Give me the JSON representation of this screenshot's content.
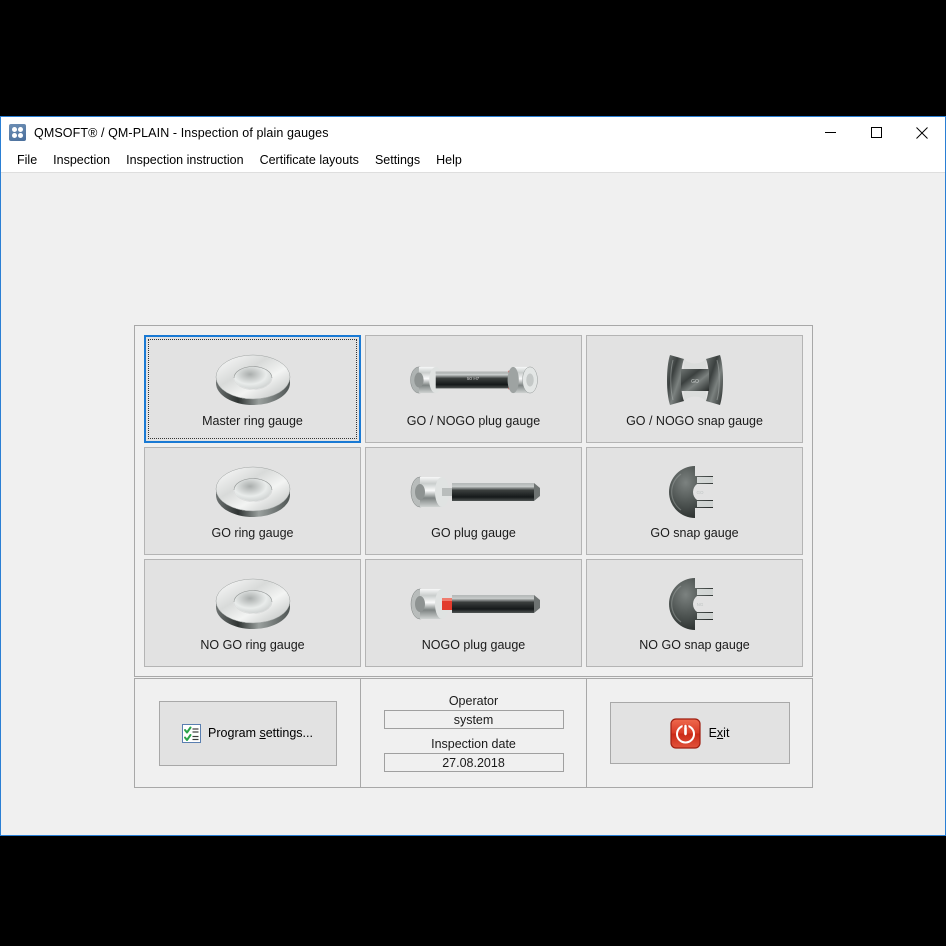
{
  "window": {
    "title": "QMSOFT® / QM-PLAIN - Inspection of plain gauges",
    "app_icon": "qmsoft-app-icon",
    "controls": {
      "minimize": "minimize-icon",
      "maximize": "maximize-icon",
      "close": "close-icon"
    }
  },
  "menu": {
    "items": [
      {
        "label": "File"
      },
      {
        "label": "Inspection"
      },
      {
        "label": "Inspection instruction"
      },
      {
        "label": "Certificate layouts"
      },
      {
        "label": "Settings"
      },
      {
        "label": "Help"
      }
    ]
  },
  "gauges": {
    "tiles": [
      {
        "label": "Master ring gauge",
        "art": "ring-gauge-image",
        "selected": true
      },
      {
        "label": "GO / NOGO plug gauge",
        "art": "double-plug-gauge-image",
        "selected": false
      },
      {
        "label": "GO / NOGO snap gauge",
        "art": "double-snap-gauge-image",
        "selected": false
      },
      {
        "label": "GO ring gauge",
        "art": "ring-gauge-image",
        "selected": false
      },
      {
        "label": "GO plug gauge",
        "art": "plug-gauge-image",
        "selected": false
      },
      {
        "label": "GO snap gauge",
        "art": "snap-gauge-image",
        "selected": false
      },
      {
        "label": "NO GO ring gauge",
        "art": "ring-gauge-image",
        "selected": false
      },
      {
        "label": "NOGO plug gauge",
        "art": "nogo-plug-gauge-image",
        "selected": false
      },
      {
        "label": "NO GO snap gauge",
        "art": "snap-gauge-image",
        "selected": false
      }
    ]
  },
  "footer": {
    "program_settings": {
      "label_pre": "Program ",
      "label_key": "s",
      "label_post": "ettings...",
      "icon": "checklist-icon"
    },
    "operator": {
      "label": "Operator",
      "value": "system"
    },
    "inspection_date": {
      "label": "Inspection date",
      "value": "27.08.2018"
    },
    "exit": {
      "label_pre": "E",
      "label_key": "x",
      "label_post": "it",
      "icon": "power-icon"
    }
  },
  "colors": {
    "accent": "#1a7ad4",
    "window_bg": "#f0f0f0",
    "tile_bg": "#e2e2e2",
    "border": "#a8a8a8",
    "exit_red": "#d8342a"
  }
}
